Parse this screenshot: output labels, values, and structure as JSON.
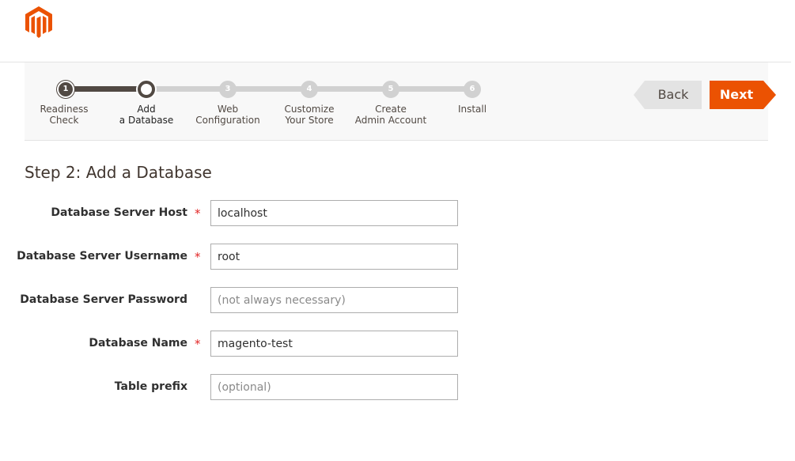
{
  "header": {
    "logo_icon": "magento-logo-icon",
    "brand_color": "#eb5202"
  },
  "wizard": {
    "steps": [
      {
        "number": "1",
        "label_line1": "Readiness",
        "label_line2": "Check",
        "state": "done"
      },
      {
        "number": "2",
        "label_line1": "Add",
        "label_line2": "a Database",
        "state": "current"
      },
      {
        "number": "3",
        "label_line1": "Web",
        "label_line2": "Configuration",
        "state": "todo"
      },
      {
        "number": "4",
        "label_line1": "Customize",
        "label_line2": "Your Store",
        "state": "todo"
      },
      {
        "number": "5",
        "label_line1": "Create",
        "label_line2": "Admin Account",
        "state": "todo"
      },
      {
        "number": "6",
        "label_line1": "Install",
        "label_line2": "",
        "state": "todo"
      }
    ],
    "back_label": "Back",
    "next_label": "Next"
  },
  "form": {
    "title": "Step 2: Add a Database",
    "fields": [
      {
        "label": "Database Server Host",
        "required": true,
        "value": "localhost",
        "placeholder": ""
      },
      {
        "label": "Database Server Username",
        "required": true,
        "value": "root",
        "placeholder": ""
      },
      {
        "label": "Database Server Password",
        "required": false,
        "value": "",
        "placeholder": "(not always necessary)"
      },
      {
        "label": "Database Name",
        "required": true,
        "value": "magento-test",
        "placeholder": ""
      },
      {
        "label": "Table prefix",
        "required": false,
        "value": "",
        "placeholder": "(optional)"
      }
    ],
    "required_mark": "*"
  }
}
